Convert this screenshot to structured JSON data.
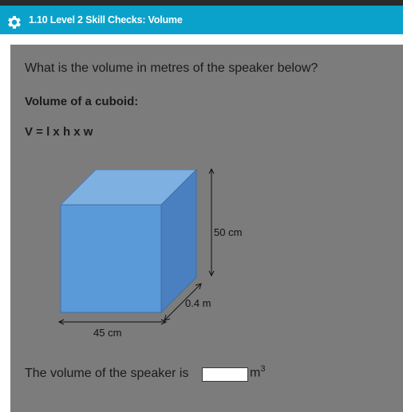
{
  "header": {
    "title": "1.10 Level 2 Skill Checks: Volume",
    "icon": "gear-icon",
    "color": "#0aa2cb"
  },
  "question": {
    "prompt": "What is the volume in metres of the speaker below?",
    "subheading": "Volume of a cuboid:",
    "formula": "V = l x h x w"
  },
  "figure": {
    "height_label": "50 cm",
    "depth_label": "0.4 m",
    "width_label": "45 cm",
    "front_color": "#5b9ad8",
    "top_color": "#7fb0e2",
    "side_color": "#4a80bf"
  },
  "answer": {
    "prefix": "The volume of the speaker is",
    "value": "",
    "unit": "m",
    "unit_exponent": "3"
  }
}
